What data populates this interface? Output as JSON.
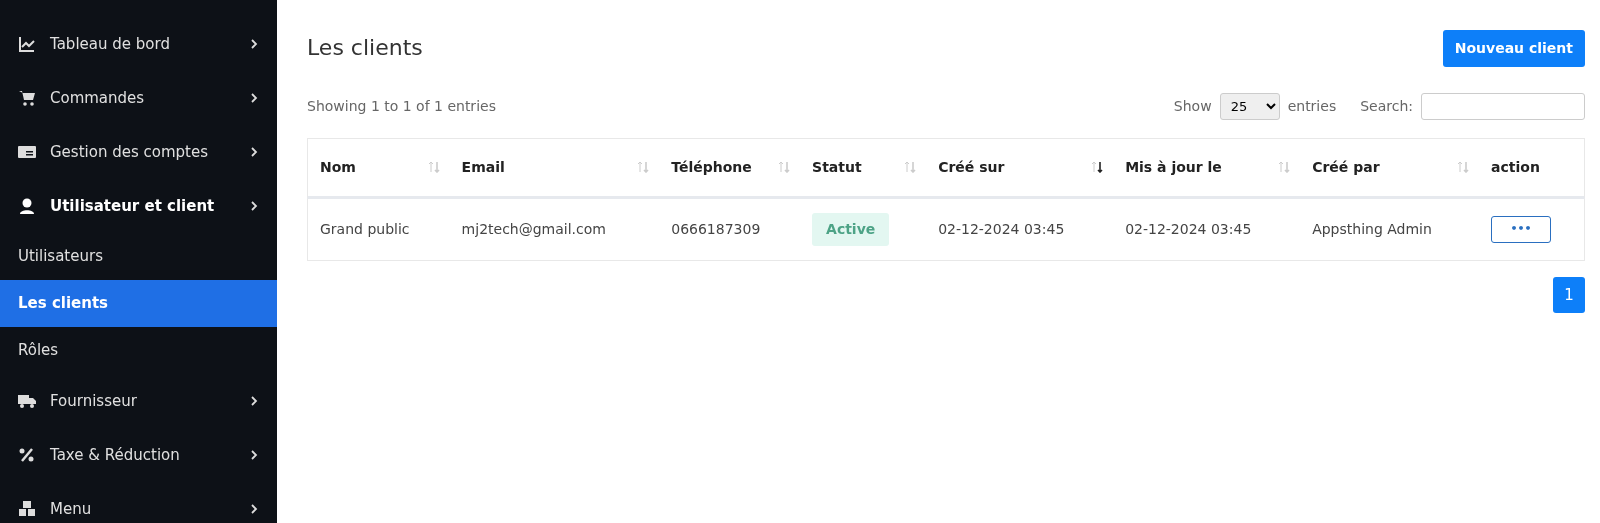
{
  "sidebar": {
    "items": [
      {
        "label": "Tableau de bord",
        "expanded": false
      },
      {
        "label": "Commandes",
        "expanded": false
      },
      {
        "label": "Gestion des comptes",
        "expanded": false
      },
      {
        "label": "Utilisateur et client",
        "expanded": true,
        "children": [
          {
            "label": "Utilisateurs",
            "selected": false
          },
          {
            "label": "Les clients",
            "selected": true
          },
          {
            "label": "Rôles",
            "selected": false
          }
        ]
      },
      {
        "label": "Fournisseur",
        "expanded": false
      },
      {
        "label": "Taxe & Réduction",
        "expanded": false
      },
      {
        "label": "Menu",
        "expanded": false
      }
    ]
  },
  "page": {
    "title": "Les clients",
    "new_button": "Nouveau client"
  },
  "table_info": "Showing 1 to 1 of 1 entries",
  "length": {
    "show": "Show",
    "value": "25",
    "entries": "entries"
  },
  "search": {
    "label": "Search:"
  },
  "table": {
    "columns": [
      {
        "label": "Nom",
        "sortable": true,
        "sorted_descending": false
      },
      {
        "label": "Email",
        "sortable": true,
        "sorted_descending": false
      },
      {
        "label": "Téléphone",
        "sortable": true,
        "sorted_descending": false
      },
      {
        "label": "Statut",
        "sortable": true,
        "sorted_descending": false
      },
      {
        "label": "Créé sur",
        "sortable": true,
        "sorted_descending": true
      },
      {
        "label": "Mis à jour le",
        "sortable": true,
        "sorted_descending": false
      },
      {
        "label": "Créé par",
        "sortable": true,
        "sorted_descending": false
      },
      {
        "label": "action",
        "sortable": false
      }
    ],
    "rows": [
      {
        "cells": [
          "Grand public",
          "mj2tech@gmail.com",
          "0666187309",
          "Active",
          "02-12-2024 03:45",
          "02-12-2024 03:45",
          "Appsthing Admin",
          "•••"
        ]
      }
    ]
  },
  "pagination": [
    {
      "label": "1",
      "selected": true
    }
  ]
}
